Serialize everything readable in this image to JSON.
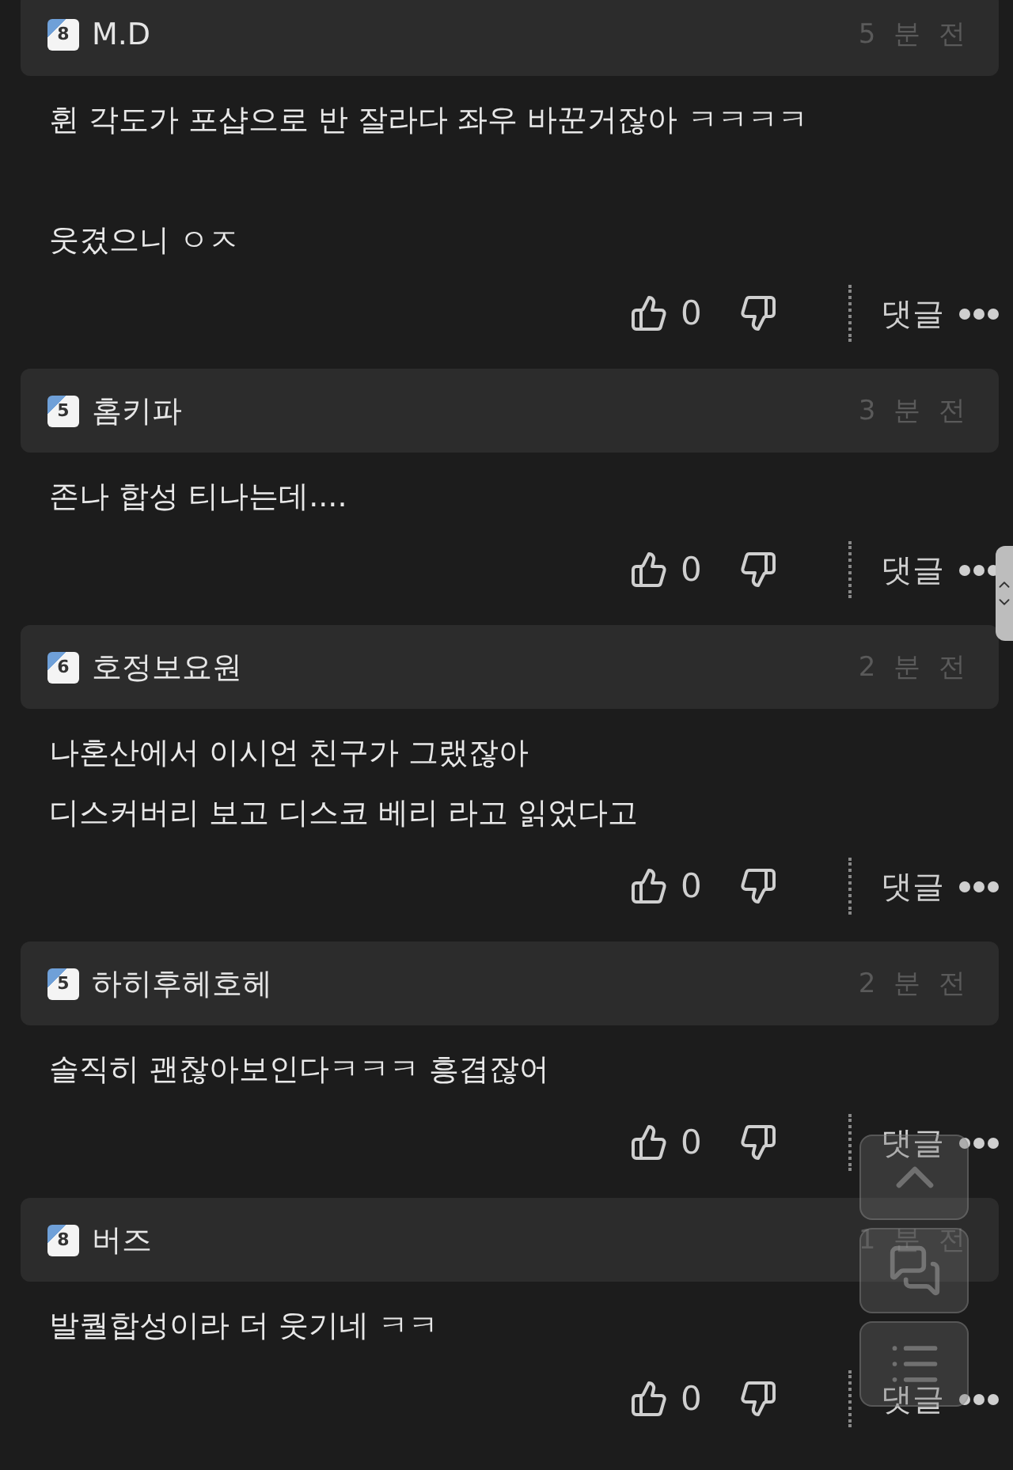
{
  "comments": [
    {
      "author": "M.D",
      "badge": "8",
      "time": "5 분 전",
      "paragraphs": [
        [
          "휜 각도가 포샵으로 반 잘라다 좌우 바꾼거잖아 ㅋㅋㅋㅋ"
        ],
        [
          "웃겼으니 ㅇㅈ"
        ]
      ],
      "likes": "0",
      "reply": "댓글"
    },
    {
      "author": "홈키파",
      "badge": "5",
      "time": "3 분 전",
      "paragraphs": [
        [
          "존나 합성 티나는데...."
        ]
      ],
      "likes": "0",
      "reply": "댓글"
    },
    {
      "author": "호정보요원",
      "badge": "6",
      "time": "2 분 전",
      "paragraphs": [
        [
          "나혼산에서 이시언 친구가 그랬잖아",
          "디스커버리 보고 디스코 베리 라고 읽었다고"
        ]
      ],
      "likes": "0",
      "reply": "댓글"
    },
    {
      "author": "하히후헤호헤",
      "badge": "5",
      "time": "2 분 전",
      "paragraphs": [
        [
          "솔직히 괜찮아보인다ㅋㅋㅋ 흥겹잖어"
        ]
      ],
      "likes": "0",
      "reply": "댓글"
    },
    {
      "author": "버즈",
      "badge": "8",
      "time": "1 분 전",
      "paragraphs": [
        [
          "발퀄합성이라 더 웃기네 ㅋㅋ"
        ]
      ],
      "likes": "0",
      "reply": "댓글"
    }
  ],
  "floating_buttons": [
    {
      "kind": "top"
    },
    {
      "kind": "comments"
    },
    {
      "kind": "list"
    }
  ]
}
